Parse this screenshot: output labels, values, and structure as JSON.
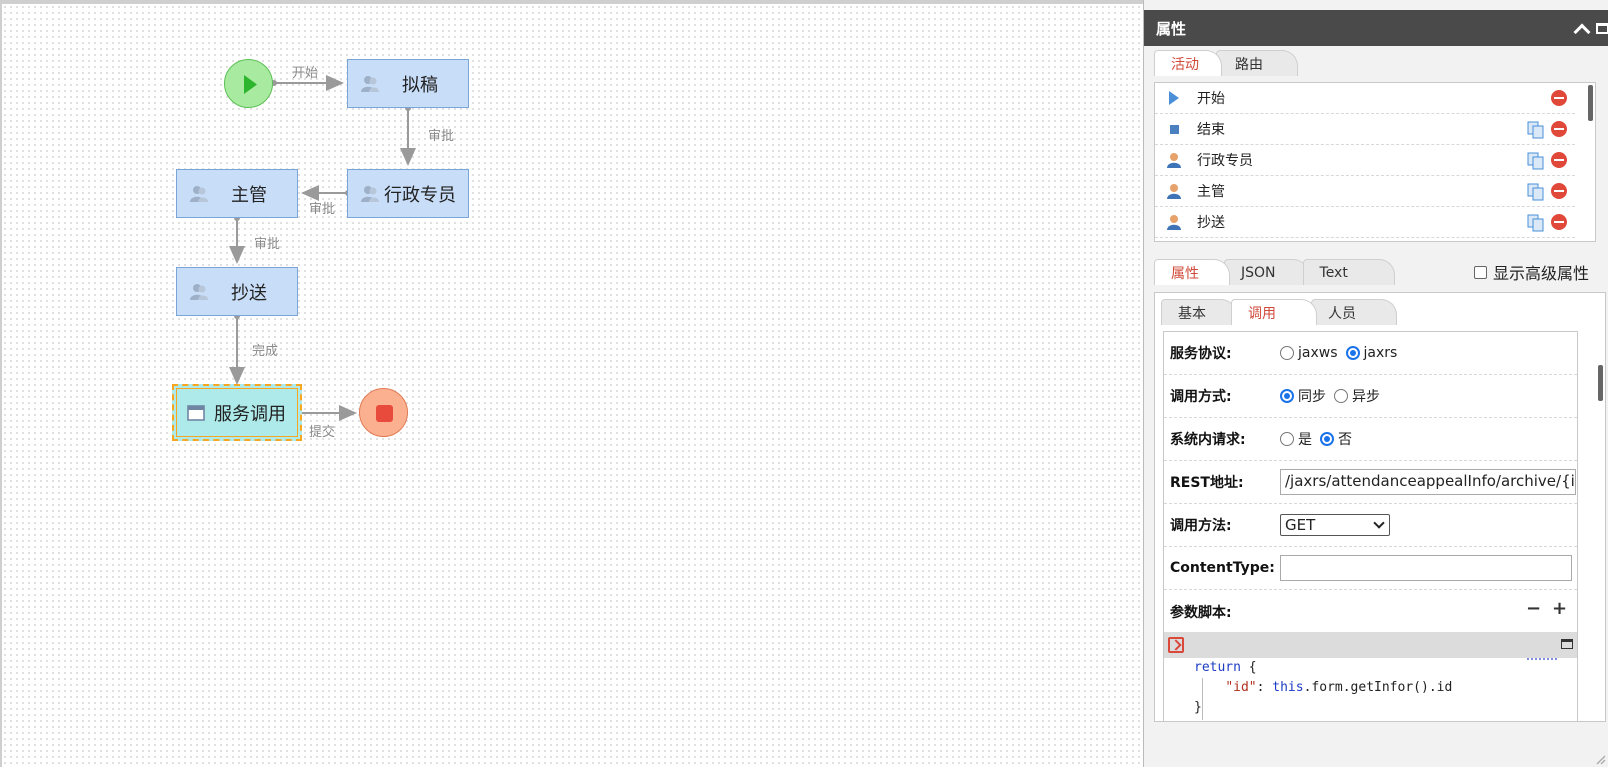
{
  "flow": {
    "nodes": {
      "start_label": "开始",
      "draft": "拟稿",
      "admin": "行政专员",
      "supervisor": "主管",
      "cc": "抄送",
      "service": "服务调用"
    },
    "edges": {
      "start_to_draft": "开始",
      "draft_to_admin": "审批",
      "admin_to_supervisor": "审批",
      "supervisor_to_cc": "审批",
      "cc_to_service": "完成",
      "service_to_end": "提交"
    }
  },
  "panel": {
    "title": "属性",
    "top_tabs": [
      "活动",
      "路由"
    ],
    "activities": [
      {
        "label": "开始",
        "icon": "triangle-play-icon",
        "copy": false
      },
      {
        "label": "结束",
        "icon": "square-stop-icon",
        "copy": true
      },
      {
        "label": "行政专员",
        "icon": "person-icon",
        "copy": true
      },
      {
        "label": "主管",
        "icon": "person-icon",
        "copy": true
      },
      {
        "label": "抄送",
        "icon": "person-icon",
        "copy": true
      }
    ],
    "prop_tabs": [
      "属性",
      "JSON",
      "Text"
    ],
    "show_advanced": "显示高级属性",
    "sub_tabs": [
      "基本",
      "调用",
      "人员"
    ],
    "form": {
      "protocol": {
        "label": "服务协议:",
        "options": [
          "jaxws",
          "jaxrs"
        ],
        "selected": "jaxrs"
      },
      "call_mode": {
        "label": "调用方式:",
        "options": [
          "同步",
          "异步"
        ],
        "selected": "同步"
      },
      "internal": {
        "label": "系统内请求:",
        "options": [
          "是",
          "否"
        ],
        "selected": "否"
      },
      "rest_url": {
        "label": "REST地址:",
        "value": "/jaxrs/attendanceappealInfo/archive/{id}"
      },
      "method": {
        "label": "调用方法:",
        "value": "GET"
      },
      "content_type": {
        "label": "ContentType:",
        "value": ""
      },
      "script": {
        "label": "参数脚本:",
        "minus": "−",
        "plus": "+"
      }
    },
    "code": {
      "line1_kw": "return",
      "line1_rest": " {",
      "line2_key": "\"id\"",
      "line2_mid": ": ",
      "line2_kw": "this",
      "line2_rest": ".form.getInfor().id",
      "line3": "}"
    }
  },
  "colors": {
    "node_fill": "#c8ddf7",
    "selected_fill": "#aeeaea",
    "selected_border": "#f5a623",
    "start": "#a8eba0",
    "end": "#fbb18f",
    "active_tab": "#d04a3a",
    "radio_on": "#1a73e8"
  }
}
